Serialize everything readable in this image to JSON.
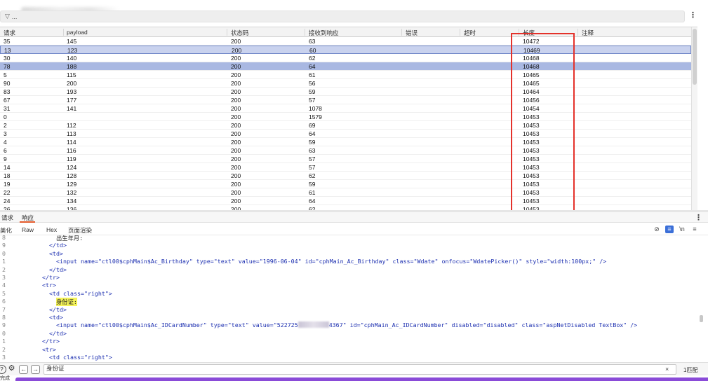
{
  "window": {
    "title_blurred": true
  },
  "filter": {
    "placeholder": "..."
  },
  "table": {
    "columns": [
      "请求",
      "payload",
      "状态码",
      "接收到响应",
      "错误",
      "超时",
      "长度",
      "注释"
    ],
    "rows": [
      [
        "35",
        "145",
        "200",
        "63",
        "",
        "",
        "10472",
        ""
      ],
      [
        "13",
        "123",
        "200",
        "60",
        "",
        "",
        "10469",
        ""
      ],
      [
        "30",
        "140",
        "200",
        "62",
        "",
        "",
        "10468",
        ""
      ],
      [
        "78",
        "188",
        "200",
        "64",
        "",
        "",
        "10468",
        ""
      ],
      [
        "5",
        "115",
        "200",
        "61",
        "",
        "",
        "10465",
        ""
      ],
      [
        "90",
        "200",
        "200",
        "56",
        "",
        "",
        "10465",
        ""
      ],
      [
        "83",
        "193",
        "200",
        "59",
        "",
        "",
        "10464",
        ""
      ],
      [
        "67",
        "177",
        "200",
        "57",
        "",
        "",
        "10456",
        ""
      ],
      [
        "31",
        "141",
        "200",
        "1078",
        "",
        "",
        "10454",
        ""
      ],
      [
        "0",
        "",
        "200",
        "1579",
        "",
        "",
        "10453",
        ""
      ],
      [
        "2",
        "112",
        "200",
        "69",
        "",
        "",
        "10453",
        ""
      ],
      [
        "3",
        "113",
        "200",
        "64",
        "",
        "",
        "10453",
        ""
      ],
      [
        "4",
        "114",
        "200",
        "59",
        "",
        "",
        "10453",
        ""
      ],
      [
        "6",
        "116",
        "200",
        "63",
        "",
        "",
        "10453",
        ""
      ],
      [
        "9",
        "119",
        "200",
        "57",
        "",
        "",
        "10453",
        ""
      ],
      [
        "14",
        "124",
        "200",
        "57",
        "",
        "",
        "10453",
        ""
      ],
      [
        "18",
        "128",
        "200",
        "62",
        "",
        "",
        "10453",
        ""
      ],
      [
        "19",
        "129",
        "200",
        "59",
        "",
        "",
        "10453",
        ""
      ],
      [
        "22",
        "132",
        "200",
        "61",
        "",
        "",
        "10453",
        ""
      ],
      [
        "24",
        "134",
        "200",
        "64",
        "",
        "",
        "10453",
        ""
      ],
      [
        "26",
        "136",
        "200",
        "62",
        "",
        "",
        "10453",
        ""
      ]
    ],
    "selected_rows": [
      1,
      3
    ],
    "highlight_color": "#e4322b"
  },
  "tabs": {
    "request": "请求",
    "response": "响应"
  },
  "subtabs": {
    "pretty": "美化",
    "raw": "Raw",
    "hex": "Hex",
    "render": "页面渲染"
  },
  "toolbar_icons": [
    "eye-off-icon",
    "format-icon",
    "newline-icon",
    "menu-icon"
  ],
  "toolbar_newline": "\\n",
  "code": {
    "line_numbers": [
      "8",
      "9",
      "0",
      "1",
      "2",
      "3",
      "4",
      "5",
      "6",
      "7",
      "8",
      "9",
      "0",
      "1",
      "2",
      "3"
    ],
    "l_birth": "出生年月:",
    "l_birth_input_pre": "<input name=\"ctl00$cphMain$Ac_Birthday\" type=\"text\" value=\"1996-06-04\" id=\"cphMain_Ac_Birthday\" class=\"Wdate\" onfocus=\"WdatePicker()\" style=\"width:100px;\" />",
    "l_td_close": "</td>",
    "l_td_open": "<td>",
    "l_tr_close": "</tr>",
    "l_tr_open": "<tr>",
    "l_td_right": "<td class=\"right\">",
    "l_idcard_label": "身份证:",
    "l_idcard_pre": "<input name=\"ctl00$cphMain$Ac_IDCardNumber\" type=\"text\" value=\"",
    "l_idcard_val_start": "522725",
    "l_idcard_val_end": "436",
    "l_idcard_val_tail": "7\"",
    "l_idcard_post": " id=\"cphMain_Ac_IDCardNumber\" disabled=\"disabled\" class=\"aspNetDisabled TextBox\" />"
  },
  "search": {
    "value": "身份证",
    "match_count": "1匹配",
    "clear": "×"
  },
  "status": {
    "label": "完成",
    "bar_color": "#8a4bd8"
  }
}
